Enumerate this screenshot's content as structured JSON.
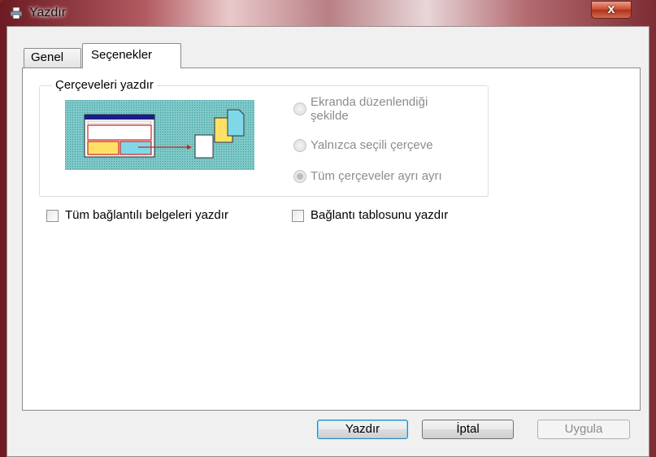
{
  "window": {
    "title": "Yazdır",
    "close_glyph": "x",
    "icon": "printer-icon"
  },
  "tabs": [
    {
      "label": "Genel",
      "active": false
    },
    {
      "label": "Seçenekler",
      "active": true
    }
  ],
  "frames_group": {
    "label": "Çerçeveleri yazdır",
    "options": [
      {
        "label_line1": "Ekranda düzenlendiği",
        "label_line2": "şekilde",
        "checked": false,
        "enabled": false
      },
      {
        "label": "Yalnızca seçili çerçeve",
        "checked": false,
        "enabled": false
      },
      {
        "label": "Tüm çerçeveler ayrı ayrı",
        "checked": true,
        "enabled": false
      }
    ]
  },
  "checkboxes": {
    "linked_docs": {
      "label": "Tüm bağlantılı belgeleri yazdır",
      "checked": false
    },
    "link_table": {
      "label": "Bağlantı tablosunu yazdır",
      "checked": false
    }
  },
  "buttons": {
    "print": "Yazdır",
    "cancel": "İptal",
    "apply": "Uygula"
  },
  "colors": {
    "accent_border": "#3c7fb1",
    "disabled_text": "#8c8c8c",
    "illustration_bg": "#8fcfcf"
  }
}
